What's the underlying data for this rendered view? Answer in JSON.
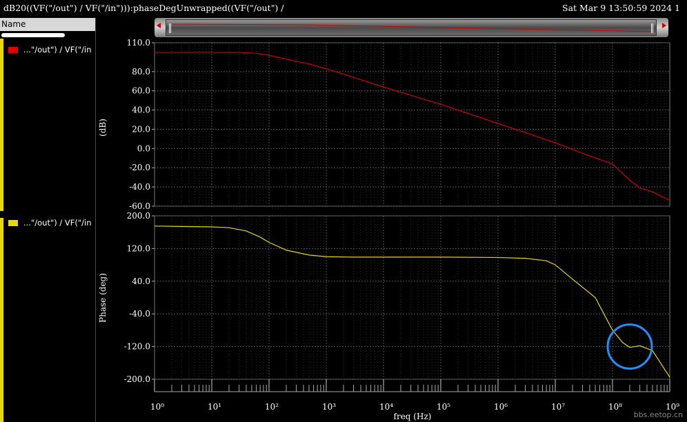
{
  "window": {
    "title": "dB20((VF(\"/out\") / VF(\"/in\"))):phaseDegUnwrapped((VF(\"/out\") /",
    "timestamp": "Sat Mar 9 13:50:59 2024  1"
  },
  "left_panel": {
    "header": "Name",
    "traces": [
      {
        "label": "...\"/out\") / VF(\"/in",
        "color": "#e00000"
      },
      {
        "label": "...\"/out\") / VF(\"/in",
        "color": "#e8d800"
      }
    ]
  },
  "chart_data": [
    {
      "type": "line",
      "ylabel": "(dB)",
      "xlabel": "",
      "xscale": "log",
      "xlim": [
        1,
        1000000000
      ],
      "ylim": [
        -60,
        110
      ],
      "y_ticks": [
        110.0,
        80.0,
        60.0,
        40.0,
        20.0,
        0.0,
        -20.0,
        -40.0,
        -60.0
      ],
      "y_tick_labels": [
        "110.0",
        "80.0",
        "60.0",
        "40.0",
        "20.0",
        "0.0",
        "-20.0",
        "-40.0",
        "-60.0"
      ],
      "grid": true,
      "series": [
        {
          "color": "#d00000",
          "x": [
            1,
            10,
            30,
            60,
            100,
            200,
            500,
            1000,
            3000,
            10000,
            100000,
            1000000,
            10000000,
            30000000,
            100000000,
            200000000,
            300000000,
            500000000,
            1000000000
          ],
          "y": [
            100,
            100,
            100,
            99,
            97,
            93,
            88,
            83,
            74,
            64,
            46,
            26,
            6,
            -5,
            -16,
            -33,
            -41,
            -45,
            -54
          ]
        }
      ]
    },
    {
      "type": "line",
      "ylabel": "Phase (deg)",
      "xlabel": "freq (Hz)",
      "xscale": "log",
      "xlim": [
        1,
        1000000000
      ],
      "ylim": [
        -200,
        200
      ],
      "y_ticks": [
        200.0,
        120.0,
        40.0,
        -40.0,
        -120.0,
        -200.0
      ],
      "y_tick_labels": [
        "200.0",
        "120.0",
        "40.0",
        "-40.0",
        "-120.0",
        "-200.0"
      ],
      "x_ticks": [
        1,
        10,
        100,
        1000,
        10000,
        100000,
        1000000,
        10000000,
        100000000,
        1000000000
      ],
      "x_tick_labels": [
        "10⁰",
        "10¹",
        "10²",
        "10³",
        "10⁴",
        "10⁵",
        "10⁶",
        "10⁷",
        "10⁸",
        "10⁹"
      ],
      "grid": true,
      "annotation": "blue circle around phase kink near 2×10⁸ Hz",
      "series": [
        {
          "color": "#e8d800",
          "x": [
            1,
            10,
            20,
            40,
            70,
            100,
            200,
            500,
            1000,
            3000,
            10000,
            100000,
            1000000,
            3000000,
            7000000,
            10000000,
            20000000,
            50000000,
            100000000,
            150000000,
            200000000,
            300000000,
            500000000,
            1000000000
          ],
          "y": [
            175,
            173,
            171,
            163,
            148,
            135,
            116,
            104,
            100,
            99,
            99,
            99,
            98,
            96,
            90,
            80,
            45,
            0,
            -80,
            -110,
            -122,
            -118,
            -130,
            -195
          ]
        }
      ]
    }
  ],
  "watermark": "bbs.eetop.cn"
}
